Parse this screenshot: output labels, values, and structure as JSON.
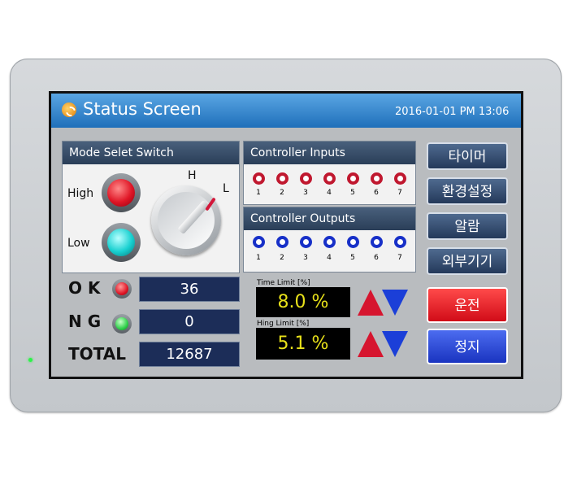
{
  "header": {
    "title": "Status Screen",
    "datetime": "2016-01-01 PM 13:06"
  },
  "mode_switch": {
    "title": "Mode Selet Switch",
    "high_label": "High",
    "low_label": "Low",
    "knob_h": "H",
    "knob_l": "L",
    "high_color": "#e01626",
    "low_color": "#18d0d0"
  },
  "controller_inputs": {
    "title": "Controller Inputs",
    "channels": [
      "1",
      "2",
      "3",
      "4",
      "5",
      "6",
      "7"
    ],
    "color": "#c0182f"
  },
  "controller_outputs": {
    "title": "Controller Outputs",
    "channels": [
      "1",
      "2",
      "3",
      "4",
      "5",
      "6",
      "7"
    ],
    "color": "#1730c8"
  },
  "counters": {
    "ok_label": "O K",
    "ok_value": "36",
    "ng_label": "N G",
    "ng_value": "0",
    "total_label": "TOTAL",
    "total_value": "12687"
  },
  "limits": {
    "time_label": "Time Limit [%]",
    "time_value": "8.0 %",
    "hing_label": "Hing Limit [%]",
    "hing_value": "5.1 %"
  },
  "buttons": {
    "timer": "타이머",
    "env_settings": "환경설정",
    "alarm": "알람",
    "external_devices": "외부기기",
    "run": "운전",
    "stop": "정지"
  }
}
